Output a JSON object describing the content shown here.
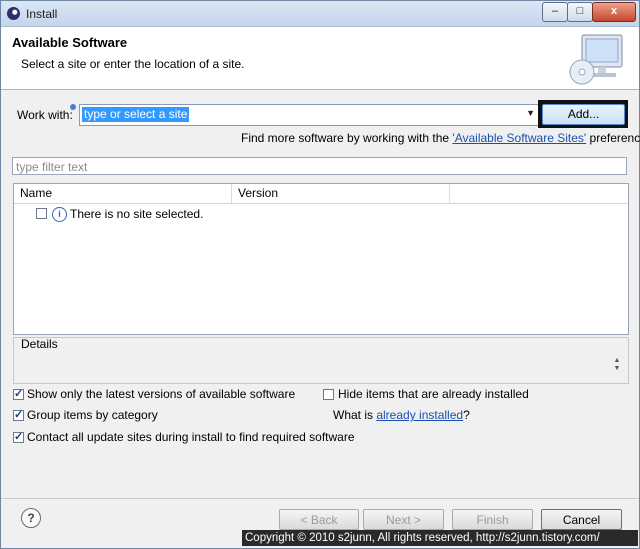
{
  "window": {
    "title": "Install",
    "controls": {
      "minimize": "–",
      "maximize": "□",
      "close": "x"
    }
  },
  "header": {
    "title": "Available Software",
    "subtitle": "Select a site or enter the location of a site."
  },
  "work_with": {
    "label": "Work with:",
    "value": "type or select a site",
    "add_label": "Add..."
  },
  "more_software": {
    "prefix": "Find more software by working with the ",
    "link": "'Available Software Sites'",
    "suffix": " preferences."
  },
  "filter": {
    "placeholder": "type filter text"
  },
  "table": {
    "columns": [
      "Name",
      "Version"
    ],
    "rows": [
      {
        "name": "There is no site selected.",
        "checked": false
      }
    ]
  },
  "details": {
    "label": "Details"
  },
  "options": {
    "latest_versions": {
      "label": "Show only the latest versions of available software",
      "checked": true
    },
    "hide_installed": {
      "label": "Hide items that are already installed",
      "checked": false
    },
    "group_category": {
      "label": "Group items by category",
      "checked": true
    },
    "what_is": {
      "prefix": "What is ",
      "link": "already installed",
      "suffix": "?"
    },
    "contact_sites": {
      "label": "Contact all update sites during install to find required software",
      "checked": true
    }
  },
  "buttons": {
    "back": "< Back",
    "next": "Next >",
    "finish": "Finish",
    "cancel": "Cancel"
  },
  "watermark": "Copyright © 2010 s2junn, All rights reserved, http://s2junn.tistory.com/"
}
